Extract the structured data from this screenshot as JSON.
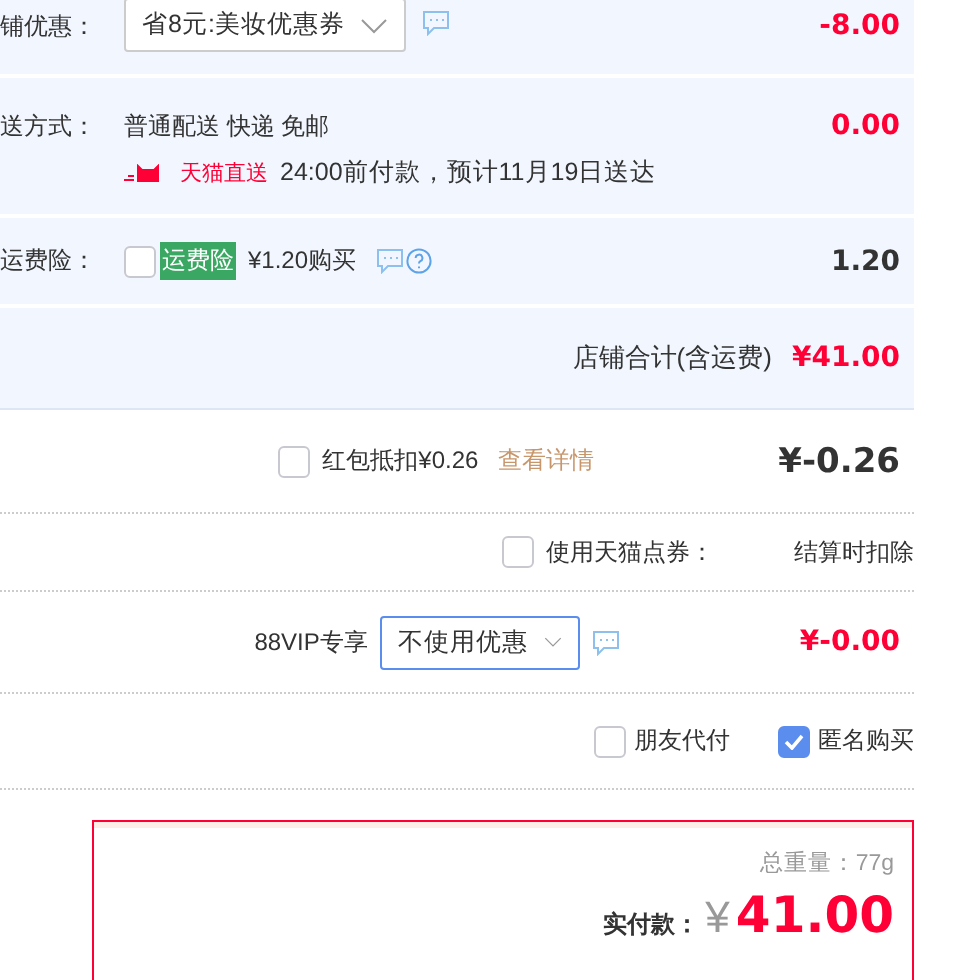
{
  "store": {
    "coupon": {
      "label": "铺优惠：",
      "select_value": "省8元:美妆优惠券",
      "amount": "-8.00"
    },
    "shipping": {
      "label": "送方式：",
      "method": "普通配送 快递 免邮",
      "badge": "天猫直送",
      "eta": "24:00前付款，预计11月19日送达",
      "amount": "0.00"
    },
    "insurance": {
      "label": "运费险：",
      "checked": false,
      "tag": "运费险",
      "price": "¥1.20购买",
      "amount": "1.20"
    },
    "subtotal": {
      "label": "店铺合计(含运费)",
      "amount": "¥41.00"
    }
  },
  "red_packet": {
    "checked": false,
    "label": "红包抵扣¥0.26",
    "link": "查看详情",
    "amount": "¥-0.26"
  },
  "points": {
    "checked": false,
    "label": "使用天猫点券：",
    "note": "结算时扣除"
  },
  "vip": {
    "label": "88VIP专享",
    "select_value": "不使用优惠",
    "amount": "¥-0.00"
  },
  "extras": [
    {
      "label": "朋友代付",
      "checked": false
    },
    {
      "label": "匿名购买",
      "checked": true
    }
  ],
  "total": {
    "weight": "总重量：77g",
    "label": "实付款：",
    "currency": "¥",
    "amount": "41.00"
  }
}
